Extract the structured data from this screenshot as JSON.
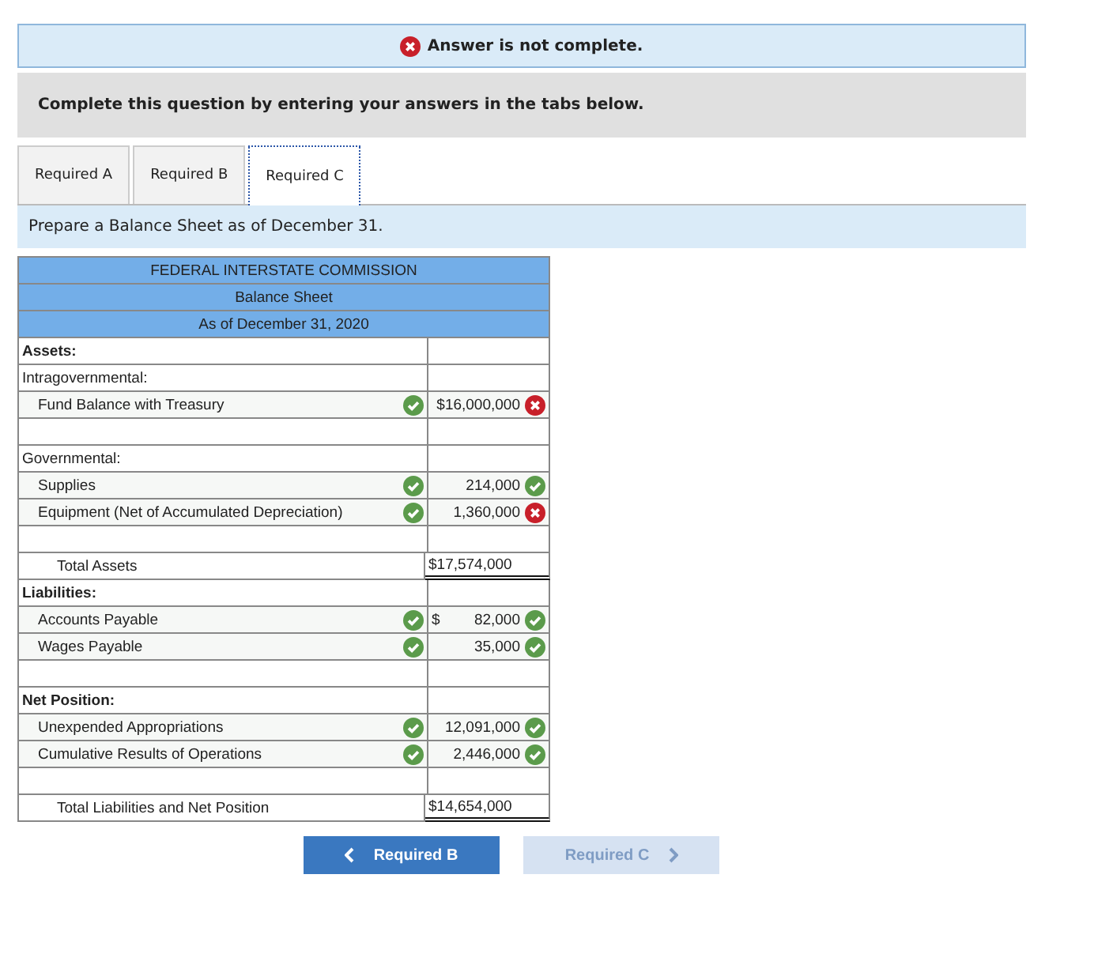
{
  "banner": {
    "complete": false,
    "text": "Answer is not complete."
  },
  "instruction": "Complete this question by entering your answers in the tabs below.",
  "tabs": [
    {
      "label": "Required A",
      "selected": false
    },
    {
      "label": "Required B",
      "selected": false
    },
    {
      "label": "Required C",
      "selected": true
    }
  ],
  "prompt": "Prepare a Balance Sheet as of December 31.",
  "sheet": {
    "titles": [
      "FEDERAL INTERSTATE COMMISSION",
      "Balance Sheet",
      "As of December 31, 2020"
    ],
    "rows": [
      {
        "kind": "heading",
        "label": "Assets:"
      },
      {
        "kind": "subheading",
        "label": "Intragovernmental:"
      },
      {
        "kind": "item",
        "label": "Fund Balance with Treasury",
        "label_correct": true,
        "value": "$16,000,000",
        "value_correct": false
      },
      {
        "kind": "blank"
      },
      {
        "kind": "subheading",
        "label": "Governmental:"
      },
      {
        "kind": "item",
        "label": "Supplies",
        "label_correct": true,
        "value": "214,000",
        "value_correct": true
      },
      {
        "kind": "item",
        "label": "Equipment (Net of Accumulated Depreciation)",
        "label_correct": true,
        "value": "1,360,000",
        "value_correct": false
      },
      {
        "kind": "blank"
      },
      {
        "kind": "total",
        "label": "Total Assets",
        "value": "$17,574,000"
      },
      {
        "kind": "heading",
        "label": "Liabilities:"
      },
      {
        "kind": "item",
        "label": "Accounts Payable",
        "label_correct": true,
        "currency": "$",
        "value": "82,000",
        "value_correct": true
      },
      {
        "kind": "item",
        "label": "Wages Payable",
        "label_correct": true,
        "value": "35,000",
        "value_correct": true
      },
      {
        "kind": "blank"
      },
      {
        "kind": "heading",
        "label": "Net Position:"
      },
      {
        "kind": "item",
        "label": "Unexpended Appropriations",
        "label_correct": true,
        "value": "12,091,000",
        "value_correct": true
      },
      {
        "kind": "item",
        "label": "Cumulative Results of Operations",
        "label_correct": true,
        "value": "2,446,000",
        "value_correct": true
      },
      {
        "kind": "blank"
      },
      {
        "kind": "total",
        "label": "Total Liabilities and Net Position",
        "value": "$14,654,000"
      }
    ]
  },
  "nav": [
    {
      "kind": "prev",
      "label": "Required B",
      "disabled": false
    },
    {
      "kind": "next",
      "label": "Required C",
      "disabled": true
    }
  ]
}
